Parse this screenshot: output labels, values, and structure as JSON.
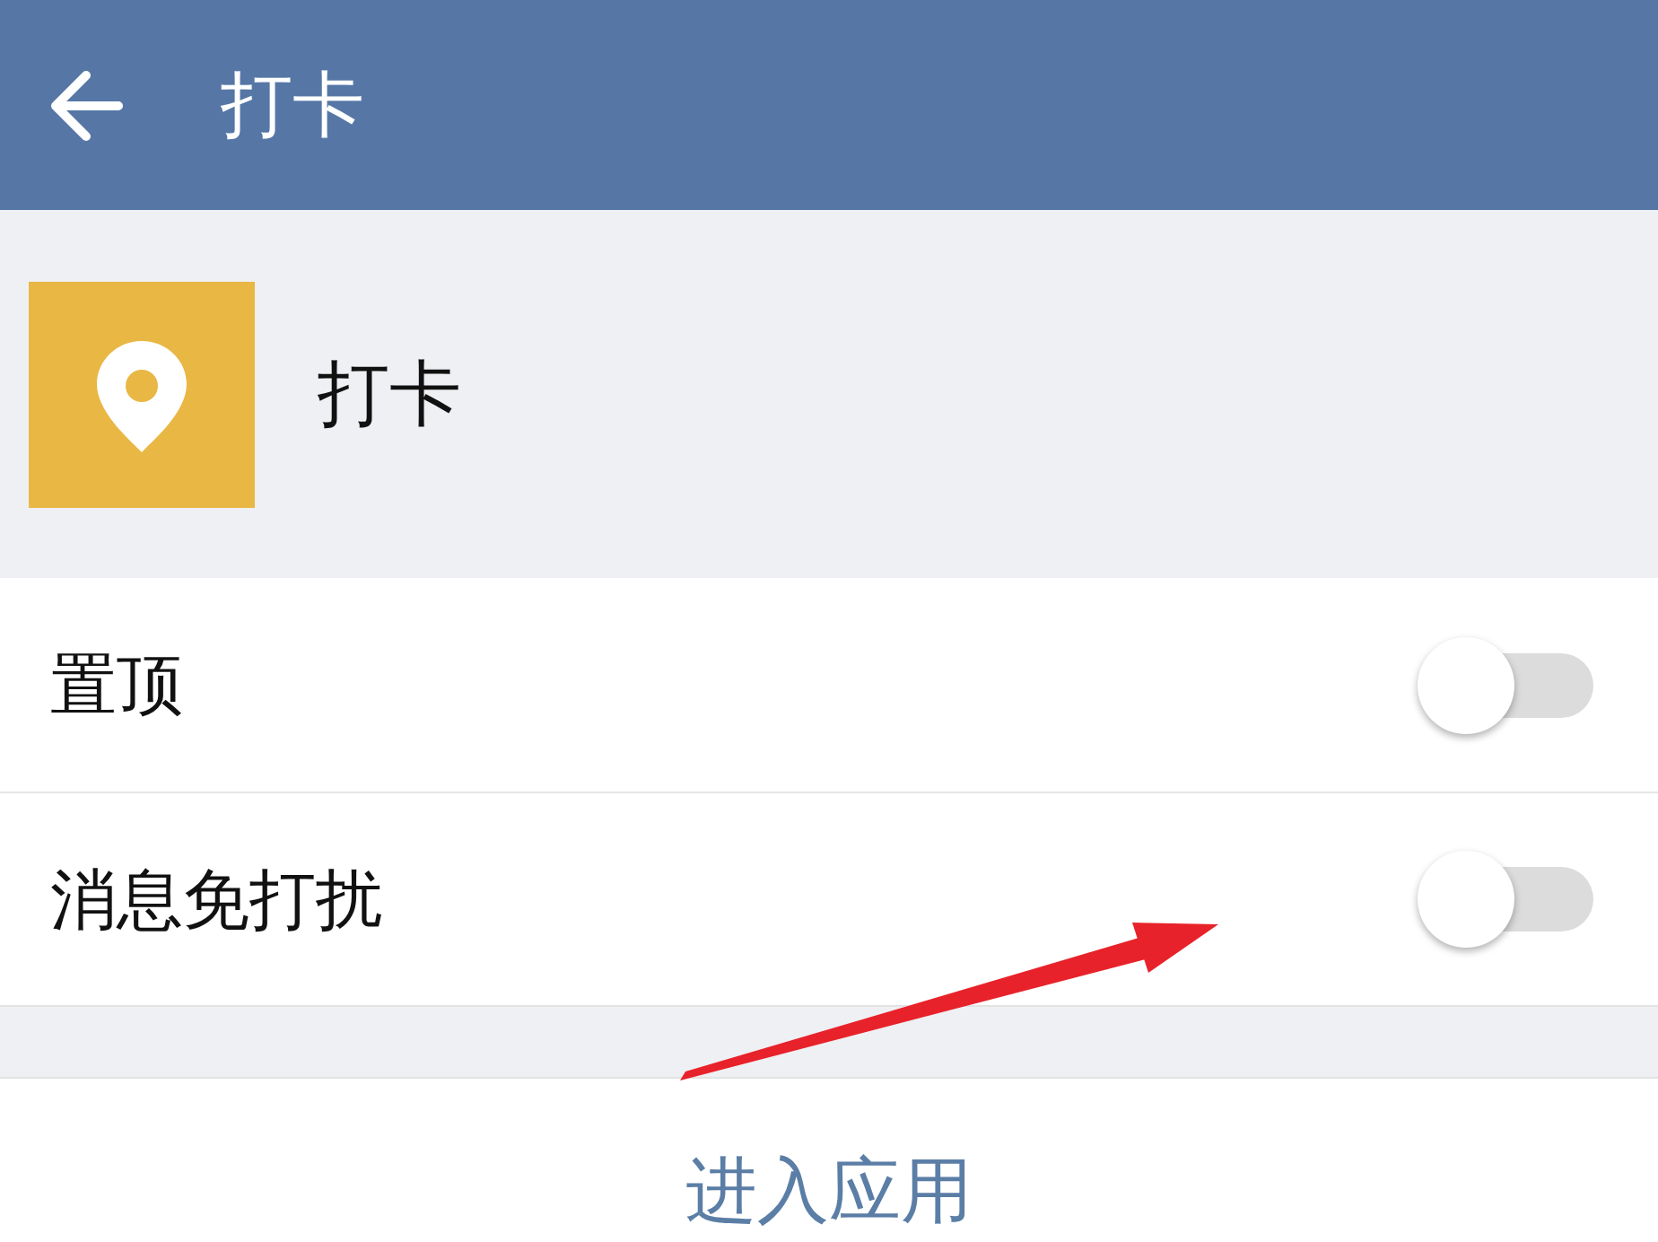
{
  "app_bar": {
    "title": "打卡"
  },
  "app": {
    "name": "打卡"
  },
  "settings": [
    {
      "label": "置顶",
      "on": false
    },
    {
      "label": "消息免打扰",
      "on": false
    }
  ],
  "action": {
    "label": "进入应用"
  }
}
